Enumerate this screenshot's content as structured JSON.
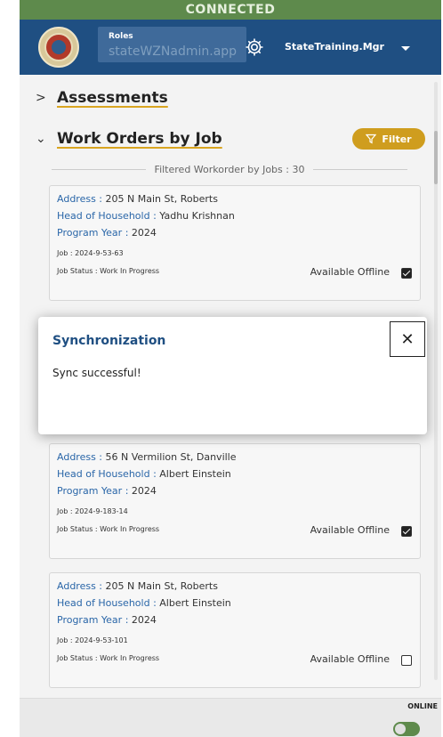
{
  "status_bar": {
    "text": "CONNECTED"
  },
  "header": {
    "roles_label": "Roles",
    "roles_value": "stateWZNadmin.app",
    "username": "StateTraining.Mgr"
  },
  "sections": [
    {
      "title": "Assessments",
      "expanded": false
    },
    {
      "title": "Work Orders by Job",
      "expanded": true
    }
  ],
  "filter_button": {
    "label": "Filter"
  },
  "count_text": "Filtered Workorder by Jobs : 30",
  "labels": {
    "address": "Address :",
    "household": "Head of Household :",
    "program_year": "Program Year :",
    "job": "Job :",
    "job_status": "Job Status :",
    "available_offline": "Available Offline"
  },
  "cards": [
    {
      "address": "205 N Main St, Roberts",
      "household": "Yadhu Krishnan",
      "program_year": "2024",
      "job": "2024-9-53-63",
      "job_status": "Work In Progress",
      "offline": true
    },
    {
      "address": "56 N Vermilion St, Danville",
      "household": "Albert Einstein",
      "program_year": "2024",
      "job": "2024-9-183-14",
      "job_status": "Work In Progress",
      "offline": true
    },
    {
      "address": "205 N Main St, Roberts",
      "household": "Albert Einstein",
      "program_year": "2024",
      "job": "2024-9-53-101",
      "job_status": "Work In Progress",
      "offline": false
    }
  ],
  "footer": {
    "online_label": "ONLINE",
    "online": true
  },
  "dialog": {
    "title": "Synchronization",
    "message": "Sync successful!",
    "close_glyph": "✕"
  },
  "colors": {
    "brand_blue": "#1f4f82",
    "connected_green": "#5e8a4c",
    "accent_gold": "#cf9d1e",
    "label_blue": "#2a66a8"
  },
  "icons": {
    "seal": "state-seal-icon",
    "gear": "gear-icon",
    "caret": "caret-down-icon",
    "filter": "filter-icon",
    "close": "close-icon"
  }
}
